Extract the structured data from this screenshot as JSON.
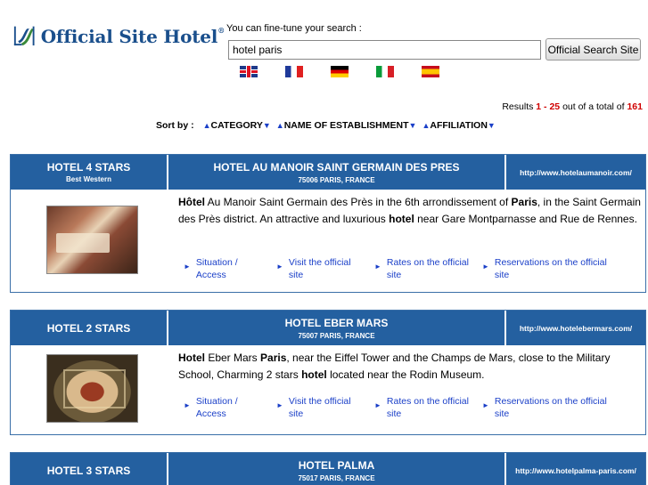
{
  "brand": {
    "name": "Official Site Hotel",
    "trademark": "®"
  },
  "search": {
    "hint": "You can fine-tune your search :",
    "value": "hotel paris",
    "button_label": "Official Search Site"
  },
  "languages": [
    "english-flag-icon",
    "french-flag-icon",
    "german-flag-icon",
    "italian-flag-icon",
    "spanish-flag-icon"
  ],
  "results": {
    "prefix": "Results ",
    "from": "1",
    "sep": " - ",
    "to": "25",
    "mid": " out of a total of ",
    "total": "161"
  },
  "sort": {
    "label": "Sort by :",
    "options": [
      "CATEGORY",
      "NAME OF ESTABLISHMENT",
      "AFFILIATION"
    ]
  },
  "colors": {
    "header_blue": "#2460a0",
    "link_blue": "#1a3fc8",
    "highlight_red": "#d00000"
  },
  "link_labels": {
    "situation_1": "Situation /",
    "situation_2": "Access",
    "visit_1": "Visit the official",
    "visit_2": "site",
    "rates_1": "Rates on the official",
    "rates_2": "site",
    "reserve_1": "Reservations on the official",
    "reserve_2": "site"
  },
  "listings": [
    {
      "category": "HOTEL 4 STARS",
      "affiliation": "Best Western",
      "name": "HOTEL AU MANOIR SAINT GERMAIN DES PRES",
      "address": "75006 PARIS, FRANCE",
      "url": "http://www.hotelaumanoir.com/",
      "desc": [
        {
          "b": "Hôtel"
        },
        {
          "t": " Au Manoir Saint Germain des Près in the 6th arrondissement of "
        },
        {
          "b": "Paris"
        },
        {
          "t": ", in the Saint Germain des Près district. An attractive and luxurious "
        },
        {
          "b": "hotel"
        },
        {
          "t": " near Gare Montparnasse and Rue de Rennes."
        }
      ]
    },
    {
      "category": "HOTEL 2 STARS",
      "affiliation": "",
      "name": "HOTEL EBER MARS",
      "address": "75007 PARIS, FRANCE",
      "url": "http://www.hotelebermars.com/",
      "desc": [
        {
          "b": "Hotel"
        },
        {
          "t": " Eber Mars "
        },
        {
          "b": "Paris"
        },
        {
          "t": ", near the Eiffel Tower and the Champs de Mars, close to the Military School, Charming 2 stars "
        },
        {
          "b": "hotel"
        },
        {
          "t": " located near the Rodin Museum."
        }
      ]
    },
    {
      "category": "HOTEL 3 STARS",
      "affiliation": "",
      "name": "HOTEL PALMA",
      "address": "75017 PARIS, FRANCE",
      "url": "http://www.hotelpalma-paris.com/",
      "desc": []
    }
  ]
}
